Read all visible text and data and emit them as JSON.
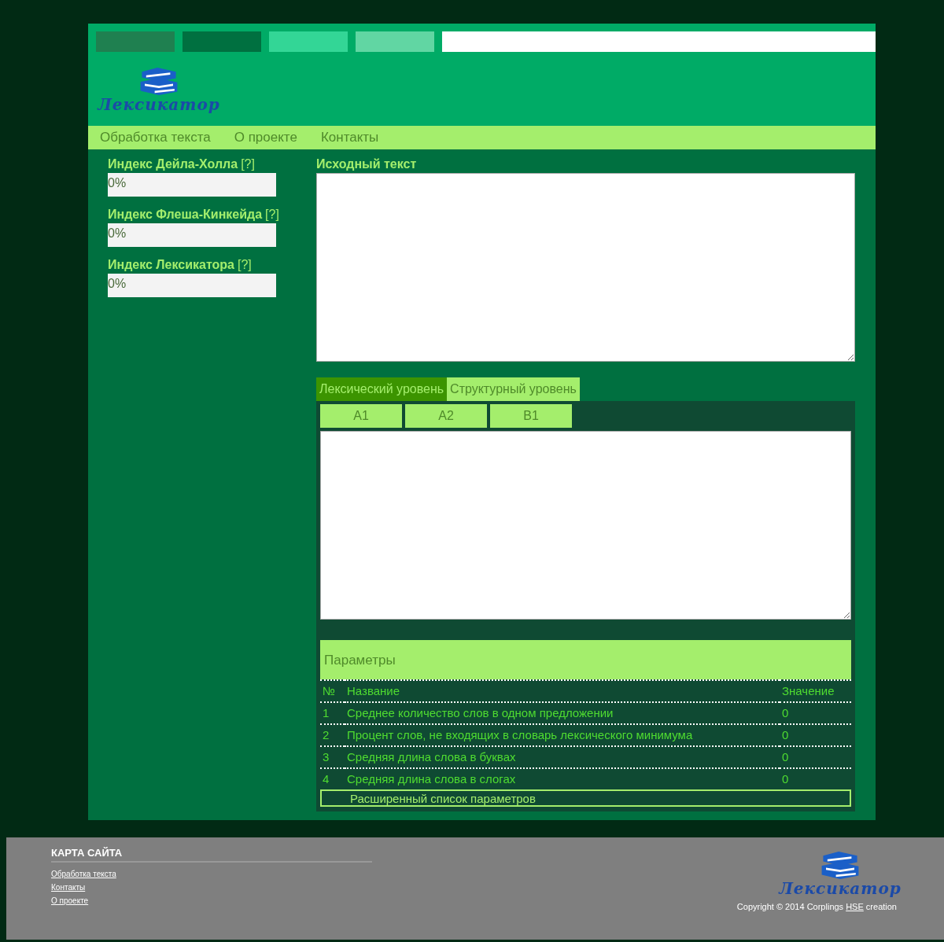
{
  "swatches": [
    {
      "color": "#1f8050"
    },
    {
      "color": "#007040"
    },
    {
      "color": "#33d696"
    },
    {
      "color": "#61d6a3"
    },
    {
      "color": "#ffffff"
    }
  ],
  "logo": {
    "text": "Лексикатор"
  },
  "nav": [
    "Обработка текста",
    "О проекте",
    "Контакты"
  ],
  "indices": [
    {
      "label": "Индекс Дейла-Холла",
      "help": "[?]",
      "value": "0%"
    },
    {
      "label": "Индекс Флеша-Кинкейда",
      "help": "[?]",
      "value": "0%"
    },
    {
      "label": "Индекс Лексикатора",
      "help": "[?]",
      "value": "0%"
    }
  ],
  "source": {
    "label": "Исходный текст"
  },
  "tabs": [
    {
      "label": "Лексический уровень",
      "selected": true
    },
    {
      "label": "Структурный уровень",
      "selected": false
    }
  ],
  "levels": [
    "A1",
    "A2",
    "B1"
  ],
  "params": {
    "title": "Параметры",
    "columns": [
      "№",
      "Название",
      "Значение"
    ],
    "rows": [
      [
        "1",
        "Среднее количество слов в одном предложении",
        "0"
      ],
      [
        "2",
        "Процент слов, не входящих в словарь лексического минимума",
        "0"
      ],
      [
        "3",
        "Средняя длина слова в буквах",
        "0"
      ],
      [
        "4",
        "Средняя длина слова в слогах",
        "0"
      ]
    ],
    "more": "Расширенный список параметров"
  },
  "footer": {
    "title": "КАРТА САЙТА",
    "links": [
      "Обработка текста",
      "Контакты",
      "О проекте"
    ],
    "logo": "Лексикатор",
    "copyright_before": "Copyright © 2014 Corplings ",
    "copyright_link": "HSE",
    "copyright_after": " creation"
  }
}
